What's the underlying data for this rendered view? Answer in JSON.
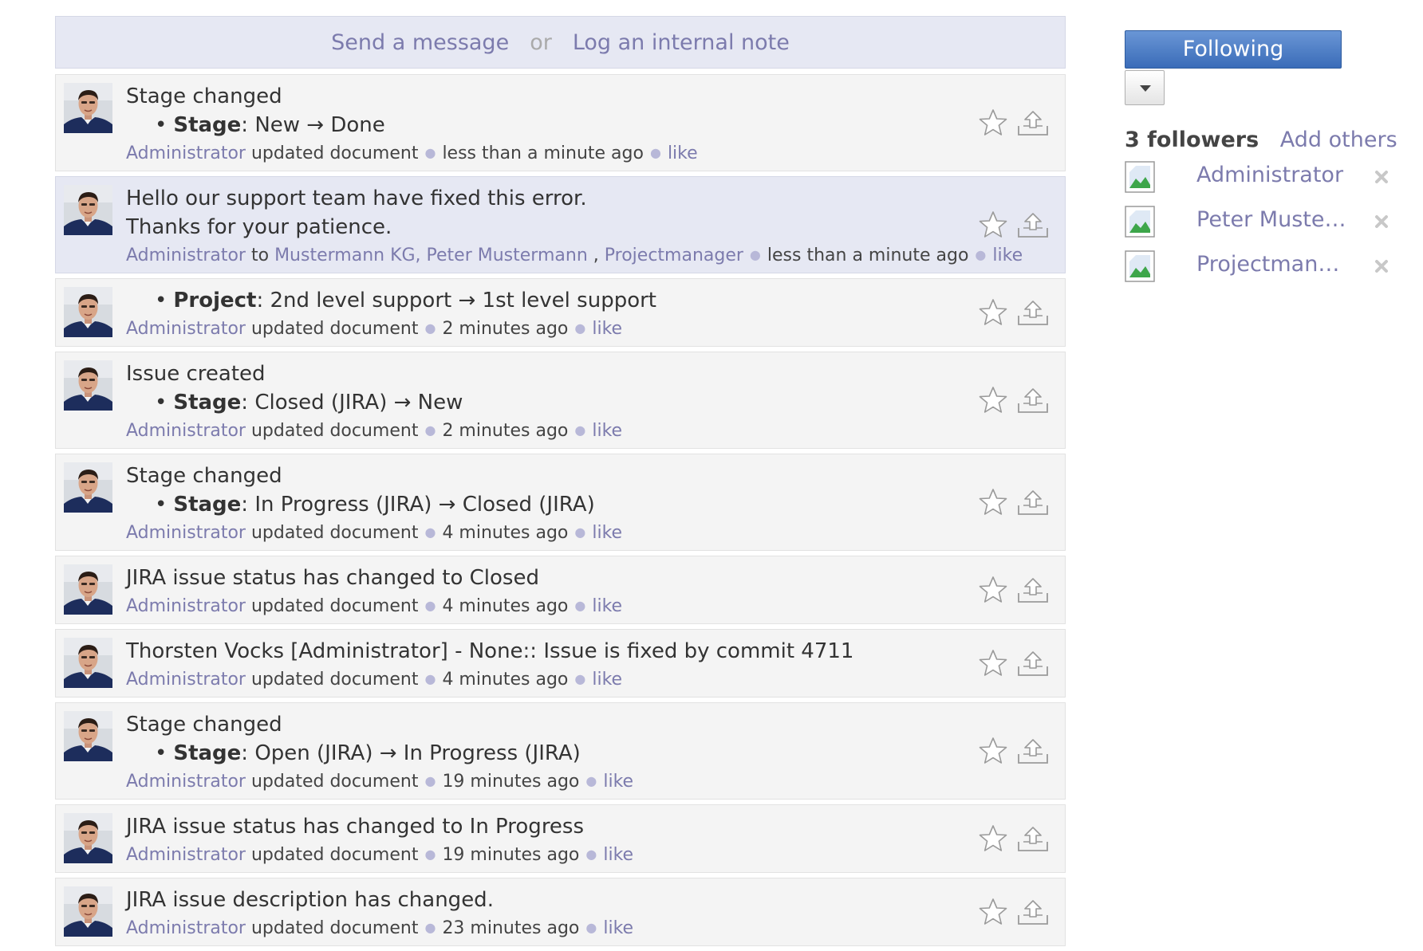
{
  "composer": {
    "send_label": "Send a message",
    "or_label": "or",
    "note_label": "Log an internal note"
  },
  "messages": [
    {
      "title": "Stage changed",
      "tracking": [
        {
          "field": "Stage",
          "sep": ":",
          "change": " New → Done"
        }
      ],
      "author": "Administrator",
      "action": "updated document",
      "time": "less than a minute ago",
      "like": "like"
    },
    {
      "body": [
        "Hello our support team have fixed this error.",
        "Thanks for your patience."
      ],
      "author": "Administrator",
      "to_word": "to",
      "recipients": "Mustermann KG, Peter Mustermann",
      "recipients_sep": ",",
      "recipient_extra": "Projectmanager",
      "time": "less than a minute ago",
      "like": "like"
    },
    {
      "tracking": [
        {
          "field": "Project",
          "sep": ":",
          "change": " 2nd level support → 1st level support"
        }
      ],
      "author": "Administrator",
      "action": "updated document",
      "time": "2 minutes ago",
      "like": "like"
    },
    {
      "title": "Issue created",
      "tracking": [
        {
          "field": "Stage",
          "sep": ":",
          "change": " Closed (JIRA) → New"
        }
      ],
      "author": "Administrator",
      "action": "updated document",
      "time": "2 minutes ago",
      "like": "like"
    },
    {
      "title": "Stage changed",
      "tracking": [
        {
          "field": "Stage",
          "sep": ":",
          "change": " In Progress (JIRA) → Closed (JIRA)"
        }
      ],
      "author": "Administrator",
      "action": "updated document",
      "time": "4 minutes ago",
      "like": "like"
    },
    {
      "title": "JIRA issue status has changed to Closed",
      "author": "Administrator",
      "action": "updated document",
      "time": "4 minutes ago",
      "like": "like"
    },
    {
      "title": "Thorsten Vocks [Administrator] - None:: Issue is fixed by commit 4711",
      "author": "Administrator",
      "action": "updated document",
      "time": "4 minutes ago",
      "like": "like"
    },
    {
      "title": "Stage changed",
      "tracking": [
        {
          "field": "Stage",
          "sep": ":",
          "change": " Open (JIRA) → In Progress (JIRA)"
        }
      ],
      "author": "Administrator",
      "action": "updated document",
      "time": "19 minutes ago",
      "like": "like"
    },
    {
      "title": "JIRA issue status has changed to In Progress",
      "author": "Administrator",
      "action": "updated document",
      "time": "19 minutes ago",
      "like": "like"
    },
    {
      "title": "JIRA issue description has changed.",
      "author": "Administrator",
      "action": "updated document",
      "time": "23 minutes ago",
      "like": "like"
    }
  ],
  "sidebar": {
    "follow_label": "Following",
    "followers_count": "3 followers",
    "add_others": "Add others",
    "followers": [
      {
        "name": "Administrator"
      },
      {
        "name": "Peter Muster..."
      },
      {
        "name": "Projectmana..."
      }
    ]
  },
  "colors": {
    "link": "#7c7bad",
    "highlight_bg": "#e6e8f3",
    "message_bg": "#f4f4f4",
    "follow_button": "#4a7cc4"
  },
  "icons": {
    "avatar": "user-avatar-icon",
    "star": "star-icon",
    "forward": "forward-icon",
    "dropdown": "caret-down-icon",
    "broken_image": "broken-image-icon",
    "remove": "remove-x-icon"
  }
}
